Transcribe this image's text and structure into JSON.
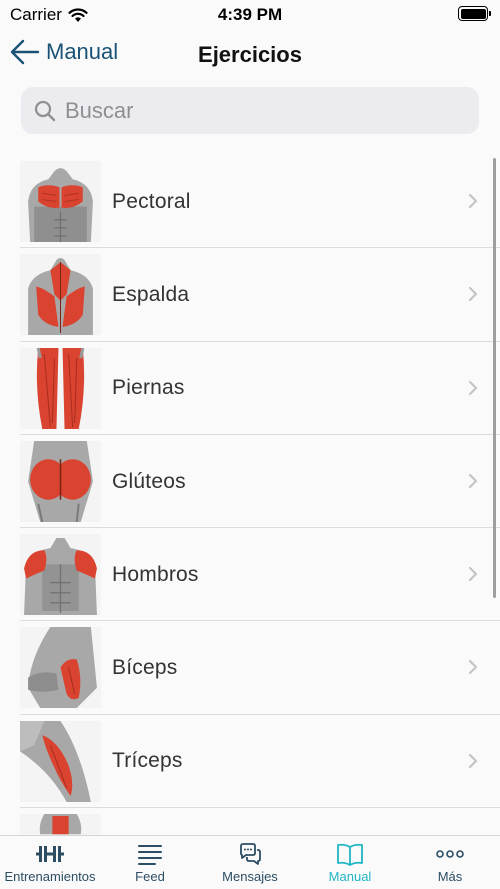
{
  "status_bar": {
    "carrier": "Carrier",
    "time": "4:39 PM"
  },
  "nav": {
    "back_label": "Manual",
    "title": "Ejercicios"
  },
  "search": {
    "placeholder": "Buscar",
    "value": ""
  },
  "exercises": [
    {
      "label": "Pectoral"
    },
    {
      "label": "Espalda"
    },
    {
      "label": "Piernas"
    },
    {
      "label": "Glúteos"
    },
    {
      "label": "Hombros"
    },
    {
      "label": "Bíceps"
    },
    {
      "label": "Tríceps"
    }
  ],
  "tabs": [
    {
      "label": "Entrenamientos",
      "icon": "dumbbell-icon"
    },
    {
      "label": "Feed",
      "icon": "feed-lines-icon"
    },
    {
      "label": "Mensajes",
      "icon": "chat-bubbles-icon"
    },
    {
      "label": "Manual",
      "icon": "open-book-icon",
      "active": true
    },
    {
      "label": "Más",
      "icon": "more-dots-icon"
    }
  ],
  "colors": {
    "nav_blue": "#1a5276",
    "tab_inactive": "#2c4d63",
    "tab_active": "#21b6c4",
    "muscle_red": "#d9432f"
  }
}
